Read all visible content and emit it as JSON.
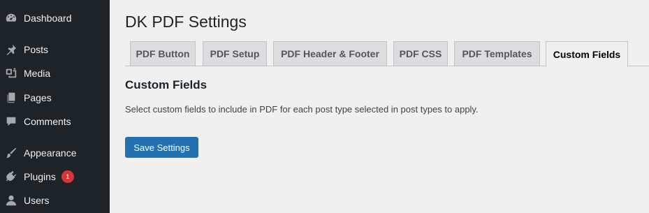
{
  "sidebar": {
    "items": [
      {
        "label": "Dashboard",
        "icon": "dashboard-icon"
      },
      {
        "label": "Posts",
        "icon": "pushpin-icon"
      },
      {
        "label": "Media",
        "icon": "media-icon"
      },
      {
        "label": "Pages",
        "icon": "pages-icon"
      },
      {
        "label": "Comments",
        "icon": "comment-icon"
      },
      {
        "label": "Appearance",
        "icon": "paintbrush-icon"
      },
      {
        "label": "Plugins",
        "icon": "plugin-icon",
        "badge": "1"
      },
      {
        "label": "Users",
        "icon": "user-icon"
      }
    ]
  },
  "main": {
    "title": "DK PDF Settings",
    "tabs": [
      {
        "label": "PDF Button"
      },
      {
        "label": "PDF Setup"
      },
      {
        "label": "PDF Header & Footer"
      },
      {
        "label": "PDF CSS"
      },
      {
        "label": "PDF Templates"
      },
      {
        "label": "Custom Fields",
        "active": true
      }
    ],
    "section_title": "Custom Fields",
    "description": "Select custom fields to include in PDF for each post type selected in post types to apply.",
    "save_label": "Save Settings"
  },
  "colors": {
    "sidebar_bg": "#1d2327",
    "accent": "#2271b1",
    "badge": "#d63638",
    "page_bg": "#f0f0f1"
  }
}
